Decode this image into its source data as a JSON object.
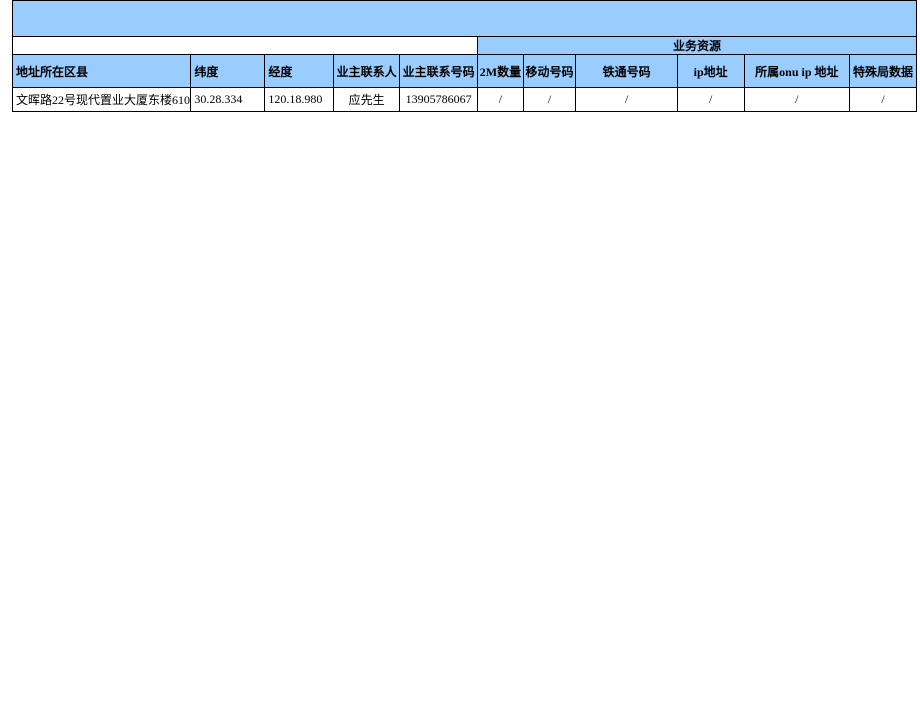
{
  "table": {
    "group_blank": "",
    "group_resources": "业务资源",
    "headers": {
      "addr": "地址所在区县",
      "lat": "纬度",
      "lon": "经度",
      "contact": "业主联系人",
      "phone": "业主联系号码",
      "qty2m": "2M数量",
      "mobile": "移动号码",
      "tietong": "铁通号码",
      "ip": "ip地址",
      "onu": "所属onu ip 地址",
      "special": "特殊局数据"
    },
    "rows": [
      {
        "addr": "文晖路22号现代置业大厦东楼610",
        "lat": "30.28.334",
        "lon": "120.18.980",
        "contact": "应先生",
        "phone": "13905786067",
        "qty2m": "/",
        "mobile": "/",
        "tietong": "/",
        "ip": "/",
        "onu": "/",
        "special": "/"
      }
    ]
  }
}
